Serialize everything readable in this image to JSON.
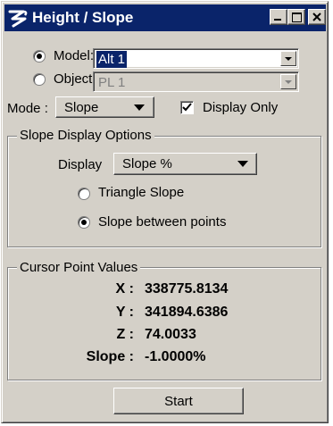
{
  "window": {
    "title": "Height / Slope",
    "controls": {
      "minimize": "minimize",
      "maximize": "maximize",
      "close": "close"
    }
  },
  "source": {
    "model_label": "Model:",
    "model_selected": true,
    "model_value": "Alt 1",
    "object_label": "Object:",
    "object_selected": false,
    "object_value": "PL 1"
  },
  "mode": {
    "label": "Mode :",
    "value": "Slope",
    "display_only_label": "Display Only",
    "display_only_checked": true
  },
  "slope_options": {
    "group_label": "Slope Display Options",
    "display_label": "Display",
    "display_value": "Slope %",
    "triangle_label": "Triangle Slope",
    "triangle_selected": false,
    "between_label": "Slope between points",
    "between_selected": true
  },
  "cursor_values": {
    "group_label": "Cursor Point Values",
    "x_label": "X :",
    "x_value": "338775.8134",
    "y_label": "Y :",
    "y_value": "341894.6386",
    "z_label": "Z :",
    "z_value": "74.0033",
    "slope_label": "Slope :",
    "slope_value": "-1.0000%"
  },
  "start_button": "Start"
}
